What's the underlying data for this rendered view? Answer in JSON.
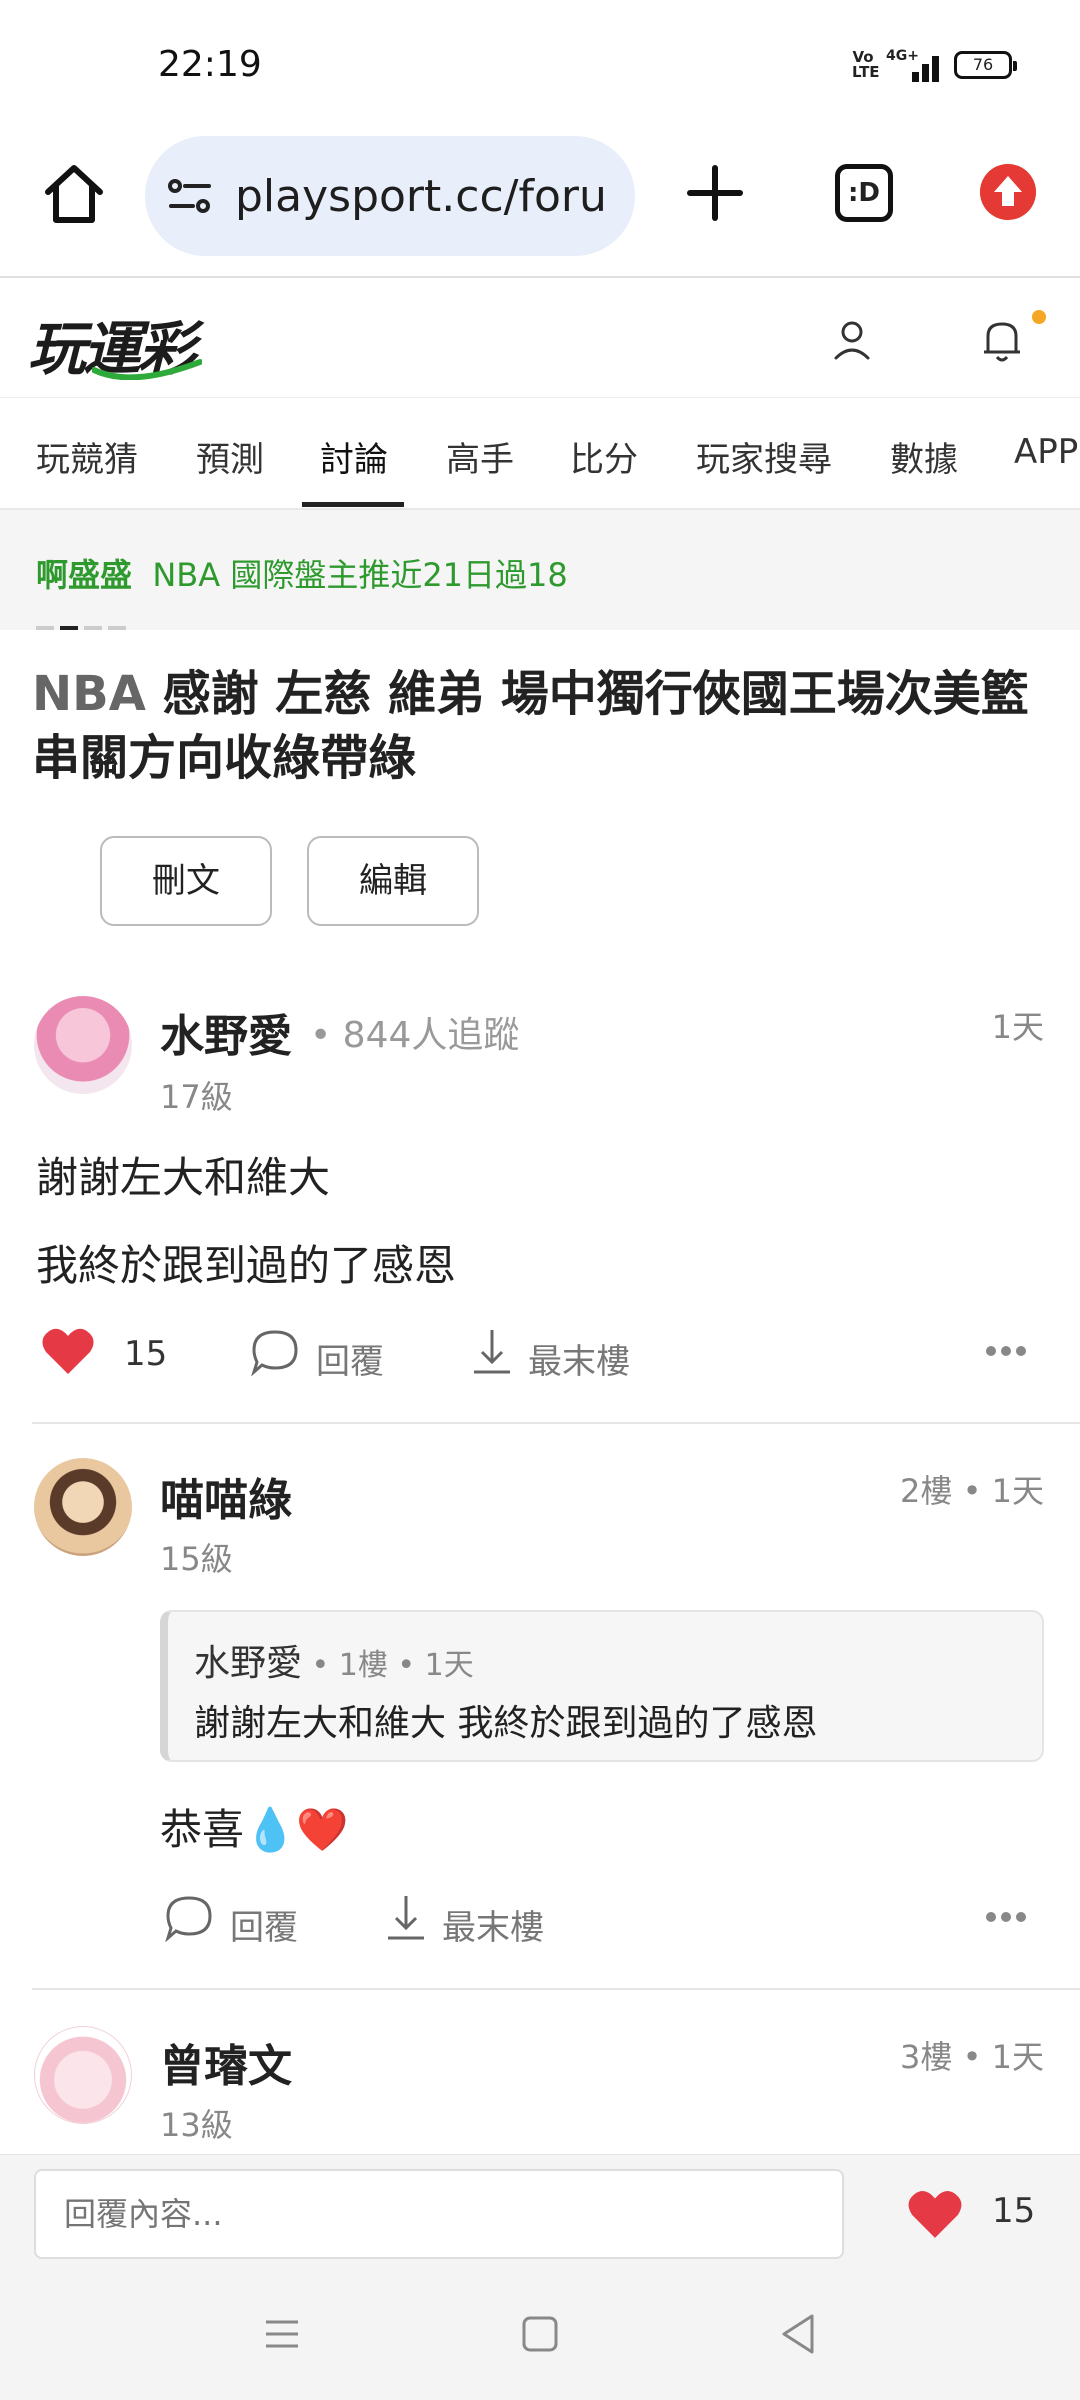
{
  "status_bar": {
    "time": "22:19",
    "volte": "Vo LTE",
    "network": "4G+",
    "battery": "76"
  },
  "browser": {
    "url": "playsport.cc/foru",
    "tabs_label": ":D"
  },
  "site": {
    "logo": "玩運彩",
    "nav_tabs": [
      "玩競猜",
      "預測",
      "討論",
      "高手",
      "比分",
      "玩家搜尋",
      "數據",
      "APP"
    ],
    "active_tab": "討論"
  },
  "banner": {
    "author": "啊盛盛",
    "text": "NBA 國際盤主推近21日過18"
  },
  "post": {
    "tag": "NBA",
    "title": "感謝 左慈 維弟 場中獨行俠國王場次美籃串關方向收綠帶綠",
    "delete_label": "刪文",
    "edit_label": "編輯"
  },
  "comments": [
    {
      "name": "水野愛",
      "followers": "• 844人追蹤",
      "level": "17級",
      "time": "1天",
      "lines": [
        "謝謝左大和維大",
        "我終於跟到過的了感恩"
      ],
      "likes": "15",
      "reply_label": "回覆",
      "last_floor_label": "最末樓"
    },
    {
      "name": "喵喵綠",
      "level": "15級",
      "time": "2樓 • 1天",
      "quote": {
        "name": "水野愛",
        "meta": " • 1樓 • 1天",
        "text": "謝謝左大和維大 我終於跟到過的了感恩"
      },
      "text": "恭喜💧❤️",
      "reply_label": "回覆",
      "last_floor_label": "最末樓"
    },
    {
      "name": "曾璿文",
      "level": "13級",
      "time": "3樓 • 1天"
    }
  ],
  "reply_bar": {
    "placeholder": "回覆內容...",
    "likes": "15"
  },
  "colors": {
    "like_red": "#e53945",
    "banner_green": "#2e9a2e",
    "url_bg": "#e9eefb",
    "notif_dot": "#f5a623"
  }
}
